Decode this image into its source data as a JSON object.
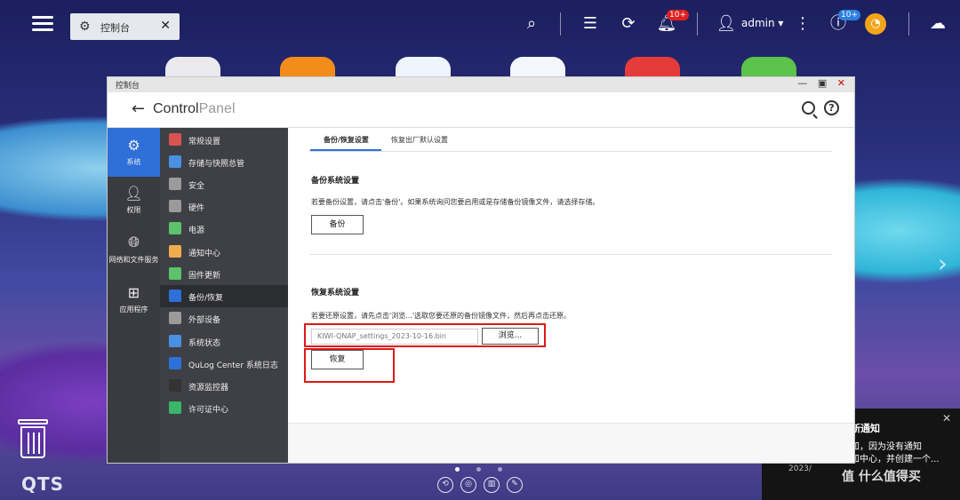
{
  "taskbar": {
    "tab_label": "控制台",
    "notif_badge": "10+",
    "update_badge": "10+",
    "user": "admin ▾"
  },
  "window": {
    "title": "控制台",
    "header_title_bold": "Control",
    "header_title_light": "Panel"
  },
  "nav": [
    {
      "label": "系统",
      "icon": "gear-icon"
    },
    {
      "label": "权限",
      "icon": "user-icon"
    },
    {
      "label": "网络和文件服务",
      "icon": "globe-icon"
    },
    {
      "label": "应用程序",
      "icon": "apps-icon"
    }
  ],
  "submenu": [
    {
      "label": "常规设置",
      "color": "#d9534f"
    },
    {
      "label": "存储与快照总管",
      "color": "#4a90e2"
    },
    {
      "label": "安全",
      "color": "#9b9b9b"
    },
    {
      "label": "硬件",
      "color": "#9b9b9b"
    },
    {
      "label": "电源",
      "color": "#5cc26b"
    },
    {
      "label": "通知中心",
      "color": "#f0ad4e"
    },
    {
      "label": "固件更新",
      "color": "#5cc26b"
    },
    {
      "label": "备份/恢复",
      "color": "#2e6fd8"
    },
    {
      "label": "外部设备",
      "color": "#9b9b9b"
    },
    {
      "label": "系统状态",
      "color": "#4a90e2"
    },
    {
      "label": "QuLog Center 系统日志",
      "color": "#2e6fd8"
    },
    {
      "label": "资源监控器",
      "color": "#333333"
    },
    {
      "label": "许可证中心",
      "color": "#3ab56b"
    }
  ],
  "tabs": [
    "备份/恢复设置",
    "恢复出厂默认设置"
  ],
  "backup": {
    "title": "备份系统设置",
    "desc": "若要备份设置，请点击'备份'。如果系统询问您要启用或是存储备份镜像文件，请选择存储。",
    "button": "备份"
  },
  "restore": {
    "title": "恢复系统设置",
    "desc": "若要还原设置，请先点击'浏览...'选取您要还原的备份镜像文件，然后再点击还原。",
    "file_value": "KIWI-QNAP_settings_2023-10-16.bin",
    "browse_button": "浏览...",
    "restore_button": "恢复"
  },
  "desktop": {
    "logo": "QTS"
  },
  "notification": {
    "title": "新通知",
    "line1": "知，因为没有通知",
    "line2": "知中心，并创建一个...",
    "time": "2023/",
    "watermark": "值 什么值得买"
  },
  "colors": {
    "accent": "#2e6fd8",
    "highlight_box": "#e01818"
  }
}
